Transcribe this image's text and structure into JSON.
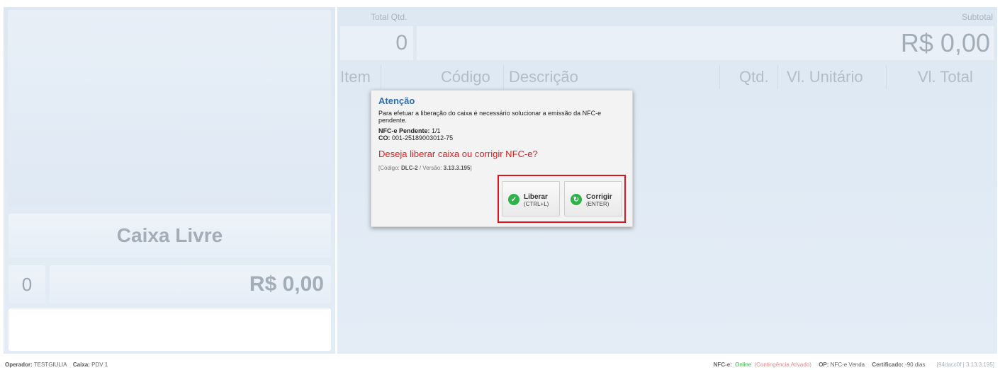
{
  "left": {
    "status_label": "Caixa Livre",
    "qty": "0",
    "total": "R$ 0,00"
  },
  "summary": {
    "total_qtd_label": "Total Qtd.",
    "total_qtd_value": "0",
    "subtotal_label": "Subtotal",
    "subtotal_value": "R$ 0,00"
  },
  "table": {
    "columns": [
      "Item",
      "Código",
      "Descrição",
      "Qtd.",
      "Vl. Unitário",
      "Vl. Total"
    ]
  },
  "dialog": {
    "title": "Atenção",
    "message": "Para efetuar a liberação do caixa é necessário solucionar a emissão da NFC-e pendente.",
    "pending_label": "NFC-e Pendente:",
    "pending_value": "1/1",
    "co_label": "CO:",
    "co_value": "001-25189003012-75",
    "question": "Deseja liberar caixa ou corrigir NFC-e?",
    "code_prefix": "[Código: ",
    "code_value": "DLC-2",
    "version_prefix": " / Versão: ",
    "version_value": "3.13.3.195",
    "code_suffix": "]",
    "buttons": [
      {
        "label": "Liberar",
        "shortcut": "(CTRL+L)",
        "icon": "check-icon"
      },
      {
        "label": "Corrigir",
        "shortcut": "(ENTER)",
        "icon": "refresh-icon"
      }
    ]
  },
  "statusbar": {
    "operator_label": "Operador:",
    "operator_value": "TESTGIULIA",
    "caixa_label": "Caixa:",
    "caixa_value": "PDV 1",
    "nfce_label": "NFC-e:",
    "nfce_online": "Online",
    "nfce_contingency": "(Contingência Ativado)",
    "op_label": "OP:",
    "op_value": "NFC-e Venda",
    "cert_label": "Certificado:",
    "cert_value": "-90 dias",
    "build": "[94dacc0f | 3.13.3.195]"
  },
  "colors": {
    "accent_title": "#2a6fb5",
    "question": "#e02020",
    "highlight": "#e0141e",
    "online": "#3cb44a"
  }
}
